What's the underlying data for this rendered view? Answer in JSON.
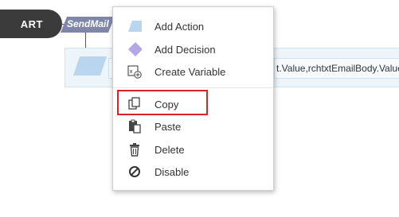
{
  "canvas": {
    "start_label": "ART",
    "sendmail_label": "SendMail",
    "expression_text": "t.Value,rchtxtEmailBody.Value"
  },
  "context_menu": {
    "items": [
      {
        "label": "Add Action",
        "icon": "action-parallelogram-icon"
      },
      {
        "label": "Add Decision",
        "icon": "decision-diamond-icon"
      },
      {
        "label": "Create Variable",
        "icon": "variable-icon"
      },
      {
        "label": "Copy",
        "icon": "copy-icon"
      },
      {
        "label": "Paste",
        "icon": "paste-icon"
      },
      {
        "label": "Delete",
        "icon": "trash-icon"
      },
      {
        "label": "Disable",
        "icon": "disable-icon"
      }
    ]
  },
  "colors": {
    "start_node": "#3b3b3b",
    "sendmail_node": "#7f86a8",
    "action_shape": "#b9d6ee",
    "decision_shape": "#b3a7e6",
    "highlight": "#d9222a",
    "menu_text": "#333333"
  }
}
